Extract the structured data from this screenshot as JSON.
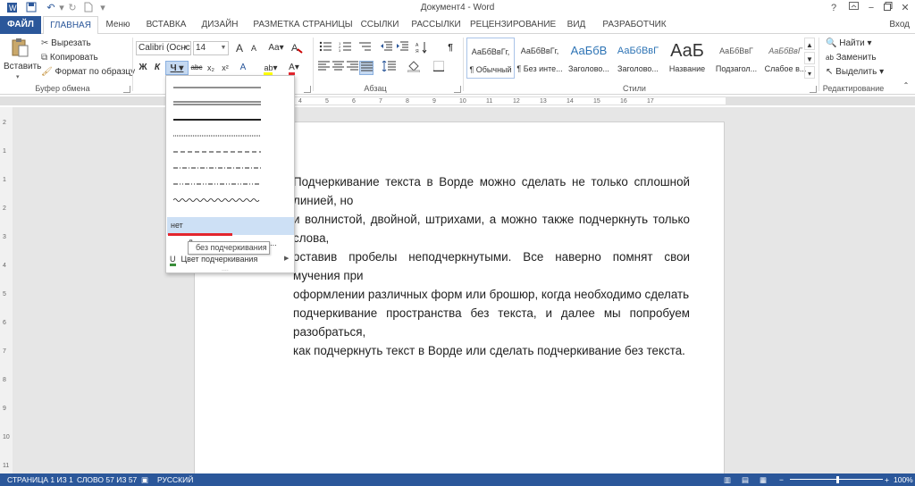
{
  "window": {
    "title": "Документ4 - Word",
    "help": "?",
    "login": "Вход"
  },
  "tabs": [
    "ФАЙЛ",
    "ГЛАВНАЯ",
    "Меню",
    "ВСТАВКА",
    "ДИЗАЙН",
    "РАЗМЕТКА СТРАНИЦЫ",
    "ССЫЛКИ",
    "РАССЫЛКИ",
    "РЕЦЕНЗИРОВАНИЕ",
    "ВИД",
    "РАЗРАБОТЧИК"
  ],
  "clipboard": {
    "paste": "Вставить",
    "cut": "Вырезать",
    "copy": "Копировать",
    "format": "Формат по образцу",
    "group": "Буфер обмена"
  },
  "font": {
    "name": "Calibri (Оснс",
    "size": "14",
    "bold": "Ж",
    "italic": "К",
    "underline": "Ч",
    "strike": "abc",
    "sub": "x₂",
    "sup": "x²",
    "grow": "A",
    "shrink": "A",
    "case": "Aa",
    "highlight": "ab",
    "color": "A"
  },
  "paragraph": {
    "group": "Абзац"
  },
  "styles": {
    "group": "Стили",
    "items": [
      {
        "preview": "АаБбВвГг,",
        "name": "¶ Обычный"
      },
      {
        "preview": "АаБбВвГг,",
        "name": "¶ Без инте..."
      },
      {
        "preview": "АаБбВ",
        "name": "Заголово..."
      },
      {
        "preview": "АаБбВвГ",
        "name": "Заголово..."
      },
      {
        "preview": "АаБ",
        "name": "Название"
      },
      {
        "preview": "АаБбВвГ",
        "name": "Подзагол..."
      },
      {
        "preview": "АаБбВвГ",
        "name": "Слабое в..."
      }
    ]
  },
  "editing": {
    "group": "Редактирование",
    "find": "Найти",
    "replace": "Заменить",
    "select": "Выделить"
  },
  "ruler": {
    "ticks": [
      "1",
      "2",
      "3",
      "4",
      "5",
      "6",
      "7",
      "8",
      "9",
      "10",
      "11",
      "12",
      "13",
      "14",
      "15",
      "16",
      "17"
    ]
  },
  "vruler": {
    "ticks": [
      "2",
      "1",
      "1",
      "2",
      "3",
      "4",
      "5",
      "6",
      "7",
      "8",
      "9",
      "10",
      "11"
    ]
  },
  "underline_menu": {
    "none": "нет",
    "more": "Другие подчеркивания...",
    "color": "Цвет подчеркивания",
    "tooltip": "без подчеркивания",
    "more_short": "Д",
    "more_tail": "..."
  },
  "document": {
    "lines": [
      "Подчеркивание текста в Ворде можно сделать не только сплошной линией, но",
      "и волнистой, двойной, штрихами, а можно также подчеркнуть только слова,",
      "оставив пробелы неподчеркнутыми. Все наверно помнят свои мучения при",
      "оформлении различных форм или брошюр, когда необходимо сделать",
      "подчеркивание пространства без текста, и далее мы попробуем разобраться,",
      "как подчеркнуть текст в Ворде или сделать подчеркивание без текста."
    ]
  },
  "status": {
    "page": "СТРАНИЦА 1 ИЗ 1",
    "words": "СЛОВО 57 ИЗ 57",
    "lang": "РУССКИЙ",
    "zoom": "100%"
  },
  "colors": {
    "accent": "#2b579a",
    "hover": "#cde0f5",
    "red": "#e3262e"
  }
}
